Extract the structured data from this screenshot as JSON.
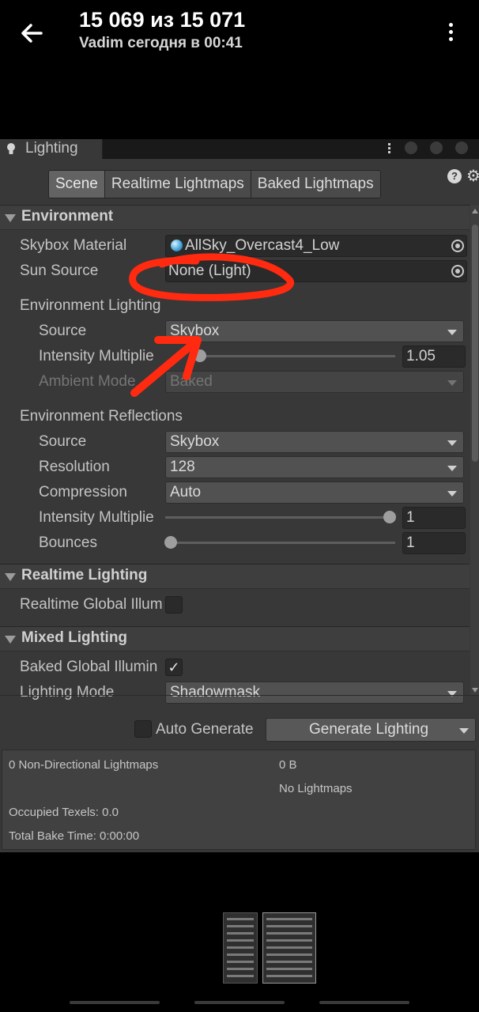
{
  "viewer": {
    "counter": "15 069 из 15 071",
    "subtitle": "Vadim сегодня в 00:41",
    "back_icon": "arrow-left-icon",
    "more_icon": "more-vertical-icon"
  },
  "unity": {
    "window_tab": "Lighting",
    "tabs": [
      {
        "label": "Scene",
        "active": true
      },
      {
        "label": "Realtime Lightmaps",
        "active": false
      },
      {
        "label": "Baked Lightmaps",
        "active": false
      }
    ],
    "environment": {
      "header": "Environment",
      "skybox_material_label": "Skybox Material",
      "skybox_material_value": "AllSky_Overcast4_Low",
      "sun_source_label": "Sun Source",
      "sun_source_value": "None (Light)",
      "lighting_group_label": "Environment Lighting",
      "source_label": "Source",
      "source_value": "Skybox",
      "intensity_label": "Intensity Multiplie",
      "intensity_value": "1.05",
      "intensity_fraction": 0.0,
      "ambient_mode_label": "Ambient Mode",
      "ambient_mode_value": "Baked",
      "reflections_group_label": "Environment Reflections",
      "refl_source_label": "Source",
      "refl_source_value": "Skybox",
      "resolution_label": "Resolution",
      "resolution_value": "128",
      "compression_label": "Compression",
      "compression_value": "Auto",
      "refl_intensity_label": "Intensity Multiplie",
      "refl_intensity_value": "1",
      "bounces_label": "Bounces",
      "bounces_value": "1"
    },
    "realtime": {
      "header": "Realtime Lighting",
      "gi_label": "Realtime Global Illum",
      "gi_checked": false
    },
    "mixed": {
      "header": "Mixed Lighting",
      "baked_gi_label": "Baked Global Illumin",
      "baked_gi_checked": true,
      "lighting_mode_label": "Lighting Mode",
      "lighting_mode_value": "Shadowmask"
    },
    "footer": {
      "auto_generate_label": "Auto Generate",
      "auto_generate_checked": false,
      "generate_button": "Generate Lighting",
      "stats": {
        "lightmaps": "0 Non-Directional Lightmaps",
        "size": "0 B",
        "no_lightmaps": "No Lightmaps",
        "occupied_texels": "Occupied Texels: 0.0",
        "bake_time": "Total Bake Time: 0:00:00"
      }
    }
  },
  "colors": {
    "annotation": "#ff2a10",
    "unity_bg": "#383838"
  }
}
